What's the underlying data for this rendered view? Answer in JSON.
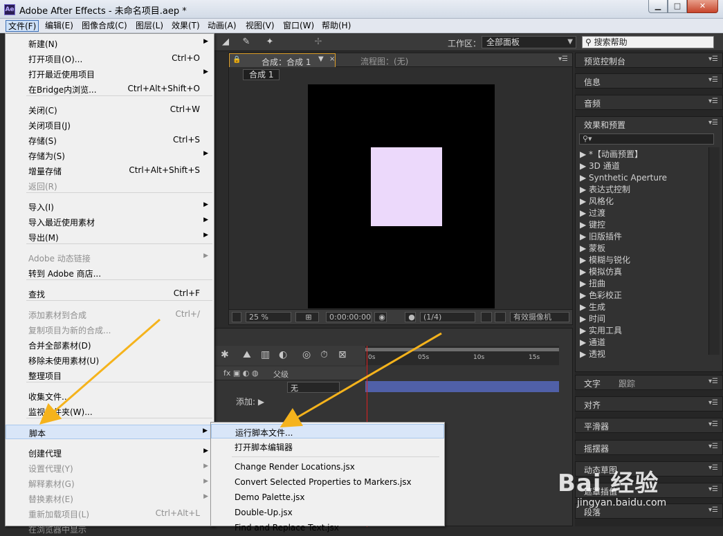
{
  "window": {
    "title": "Adobe After Effects - 未命名项目.aep *",
    "icon_text": "Ae",
    "min": "▁",
    "max": "□",
    "close": "✕"
  },
  "menubar": [
    "文件(F)",
    "编辑(E)",
    "图像合成(C)",
    "图层(L)",
    "效果(T)",
    "动画(A)",
    "视图(V)",
    "窗口(W)",
    "帮助(H)"
  ],
  "toolbar": {
    "workspace_label": "工作区：",
    "workspace_value": "全部面板",
    "search_help": "搜索帮助"
  },
  "comp_panel": {
    "tab": "合成：合成 1",
    "flow_tab": "流程图：(无)",
    "chip": "合成 1",
    "zoom": "25 %",
    "timecode": "0:00:00:00",
    "resolution": "(1/4)",
    "camera": "有效摄像机",
    "layer_color": "#ecd9fb"
  },
  "timeline": {
    "ruler": [
      "0s",
      "05s",
      "10s",
      "15s"
    ],
    "parent_col": "父级",
    "parent_value": "无",
    "add_label": "添加:"
  },
  "right_panels": {
    "preview": "预览控制台",
    "info": "信息",
    "audio": "音频",
    "effects": "效果和预置",
    "effects_list": [
      "*【动画预置】",
      "3D 通道",
      "Synthetic Aperture",
      "表达式控制",
      "风格化",
      "过渡",
      "键控",
      "旧版插件",
      "蒙板",
      "模糊与锐化",
      "模拟仿真",
      "扭曲",
      "色彩校正",
      "生成",
      "时间",
      "实用工具",
      "通道",
      "透视"
    ],
    "text": "文字",
    "tracking": "跟踪",
    "align": "对齐",
    "smoother": "平滑器",
    "wiggler": "摇摆器",
    "motion_sketch": "动态草图",
    "mask_interp": "遮罩插值",
    "paragraph": "段落"
  },
  "file_menu": {
    "items": [
      {
        "label": "新建(N)",
        "shortcut": "",
        "arrow": true,
        "disabled": false
      },
      {
        "label": "打开项目(O)...",
        "shortcut": "Ctrl+O",
        "arrow": false,
        "disabled": false
      },
      {
        "label": "打开最近使用项目",
        "shortcut": "",
        "arrow": true,
        "disabled": false
      },
      {
        "label": "在Bridge内浏览...",
        "shortcut": "Ctrl+Alt+Shift+O",
        "arrow": false,
        "disabled": false
      },
      {
        "label": "关闭(C)",
        "shortcut": "Ctrl+W",
        "arrow": false,
        "disabled": false
      },
      {
        "label": "关闭项目(J)",
        "shortcut": "",
        "arrow": false,
        "disabled": false
      },
      {
        "label": "存储(S)",
        "shortcut": "Ctrl+S",
        "arrow": false,
        "disabled": false
      },
      {
        "label": "存储为(S)",
        "shortcut": "",
        "arrow": true,
        "disabled": false
      },
      {
        "label": "增量存储",
        "shortcut": "Ctrl+Alt+Shift+S",
        "arrow": false,
        "disabled": false
      },
      {
        "label": "返回(R)",
        "shortcut": "",
        "arrow": false,
        "disabled": true
      },
      {
        "label": "导入(I)",
        "shortcut": "",
        "arrow": true,
        "disabled": false
      },
      {
        "label": "导入最近使用素材",
        "shortcut": "",
        "arrow": true,
        "disabled": false
      },
      {
        "label": "导出(M)",
        "shortcut": "",
        "arrow": true,
        "disabled": false
      },
      {
        "label": "Adobe 动态链接",
        "shortcut": "",
        "arrow": true,
        "disabled": true
      },
      {
        "label": "转到 Adobe 商店...",
        "shortcut": "",
        "arrow": false,
        "disabled": false
      },
      {
        "label": "查找",
        "shortcut": "Ctrl+F",
        "arrow": false,
        "disabled": false
      },
      {
        "label": "添加素材到合成",
        "shortcut": "Ctrl+/",
        "arrow": false,
        "disabled": true
      },
      {
        "label": "复制项目为新的合成...",
        "shortcut": "",
        "arrow": false,
        "disabled": true
      },
      {
        "label": "合并全部素材(D)",
        "shortcut": "",
        "arrow": false,
        "disabled": false
      },
      {
        "label": "移除未使用素材(U)",
        "shortcut": "",
        "arrow": false,
        "disabled": false
      },
      {
        "label": "整理项目",
        "shortcut": "",
        "arrow": false,
        "disabled": false
      },
      {
        "label": "收集文件...",
        "shortcut": "",
        "arrow": false,
        "disabled": false
      },
      {
        "label": "监视文件夹(W)...",
        "shortcut": "",
        "arrow": false,
        "disabled": false
      },
      {
        "label": "脚本",
        "shortcut": "",
        "arrow": true,
        "disabled": false
      },
      {
        "label": "创建代理",
        "shortcut": "",
        "arrow": true,
        "disabled": false
      },
      {
        "label": "设置代理(Y)",
        "shortcut": "",
        "arrow": true,
        "disabled": true
      },
      {
        "label": "解释素材(G)",
        "shortcut": "",
        "arrow": true,
        "disabled": true
      },
      {
        "label": "替换素材(E)",
        "shortcut": "",
        "arrow": true,
        "disabled": true
      },
      {
        "label": "重新加载项目(L)",
        "shortcut": "Ctrl+Alt+L",
        "arrow": false,
        "disabled": true
      },
      {
        "label": "在浏览器中显示",
        "shortcut": "",
        "arrow": false,
        "disabled": true
      }
    ]
  },
  "script_submenu": {
    "items": [
      "运行脚本文件...",
      "打开脚本编辑器",
      "Change Render Locations.jsx",
      "Convert Selected Properties to Markers.jsx",
      "Demo Palette.jsx",
      "Double-Up.jsx",
      "Find and Replace Text.jsx"
    ]
  },
  "watermark": {
    "brand": "Bai 经验",
    "url": "jingyan.baidu.com"
  },
  "colors": {
    "accent": "#e0a12a",
    "arrow": "#f5b31c",
    "highlight": "#d9e6f8"
  }
}
